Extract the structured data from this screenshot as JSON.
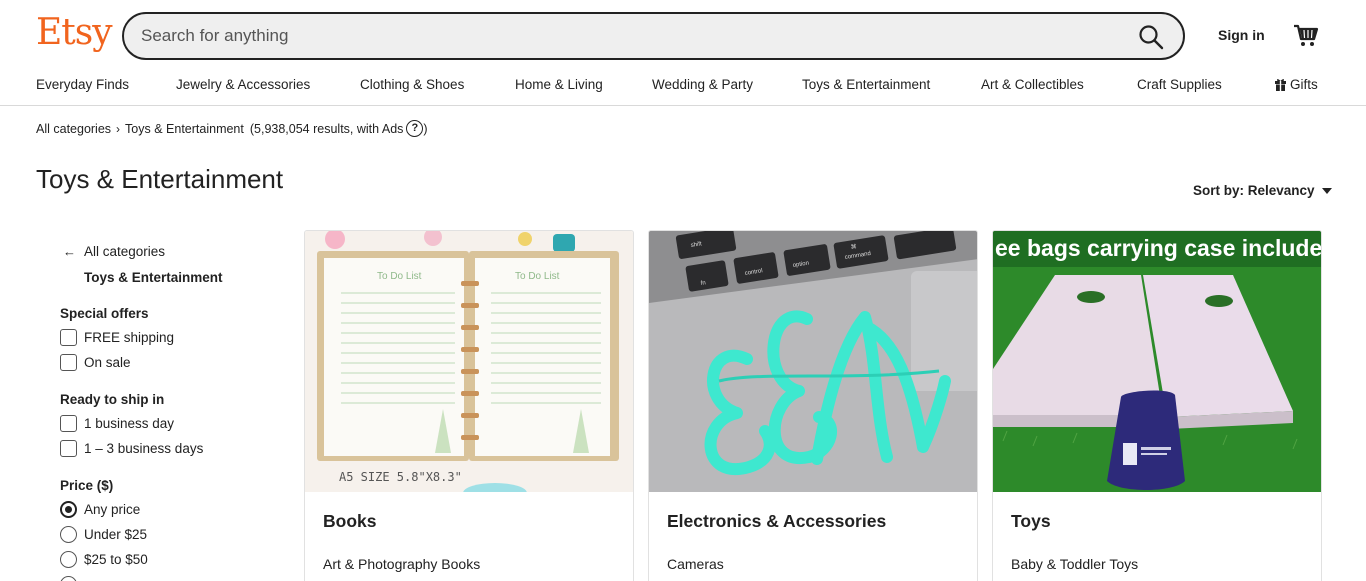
{
  "header": {
    "logo": "Etsy",
    "search_placeholder": "Search for anything",
    "sign_in": "Sign in"
  },
  "nav": [
    "Everyday Finds",
    "Jewelry & Accessories",
    "Clothing & Shoes",
    "Home & Living",
    "Wedding & Party",
    "Toys & Entertainment",
    "Art & Collectibles",
    "Craft Supplies",
    "Gifts"
  ],
  "breadcrumb": {
    "root": "All categories",
    "current": "Toys & Entertainment",
    "results": "(5,938,054 results, with Ads"
  },
  "page_title": "Toys & Entertainment",
  "sort": {
    "label": "Sort by: Relevancy"
  },
  "sidebar": {
    "back_label": "All categories",
    "current_category": "Toys & Entertainment",
    "special_offers": {
      "title": "Special offers",
      "options": [
        "FREE shipping",
        "On sale"
      ]
    },
    "ready_to_ship": {
      "title": "Ready to ship in",
      "options": [
        "1 business day",
        "1 – 3 business days"
      ]
    },
    "price": {
      "title": "Price ($)",
      "options": [
        "Any price",
        "Under $25",
        "$25 to $50"
      ],
      "selected": "Any price"
    }
  },
  "cards": [
    {
      "title": "Books",
      "subtitle": "Art & Photography Books",
      "image_text": [
        "To Do List",
        "To Do List",
        "A5 SIZE  5.8\"X8.3\""
      ]
    },
    {
      "title": "Electronics & Accessories",
      "subtitle": "Cameras",
      "image_text": [
        "shift",
        "fn",
        "control",
        "option",
        "command",
        "⌘"
      ]
    },
    {
      "title": "Toys",
      "subtitle": "Baby & Toddler Toys",
      "image_text": [
        "ee bags carrying case include"
      ]
    }
  ],
  "colors": {
    "brand": "#f1641e",
    "text": "#222222",
    "monogram": "#3ee8cf",
    "grass": "#2d8a2a"
  },
  "icons": {
    "search": "search-icon",
    "cart": "cart-icon",
    "gift": "gift-icon",
    "help": "help-icon",
    "back": "arrow-left-icon",
    "sort": "caret-down-icon"
  }
}
